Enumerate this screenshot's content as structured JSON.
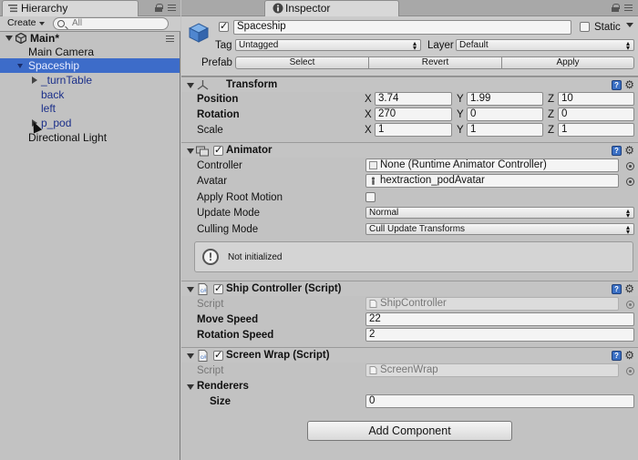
{
  "hierarchy": {
    "tab_label": "Hierarchy",
    "create_label": "Create",
    "search_placeholder": "All",
    "items": [
      {
        "label": "Main*",
        "icon": "unity-icon"
      },
      {
        "label": "Main Camera"
      },
      {
        "label": "Spaceship",
        "selected": true
      },
      {
        "label": "_turnTable"
      },
      {
        "label": "back"
      },
      {
        "label": "left"
      },
      {
        "label": "p_pod"
      },
      {
        "label": "Directional Light"
      }
    ]
  },
  "inspector": {
    "tab_label": "Inspector",
    "object_name": "Spaceship",
    "static_label": "Static",
    "tag_label": "Tag",
    "tag_value": "Untagged",
    "layer_label": "Layer",
    "layer_value": "Default",
    "prefab_label": "Prefab",
    "prefab_buttons": [
      "Select",
      "Revert",
      "Apply"
    ],
    "transform": {
      "title": "Transform",
      "position_label": "Position",
      "rotation_label": "Rotation",
      "scale_label": "Scale",
      "axis": [
        "X",
        "Y",
        "Z"
      ],
      "position": [
        "3.74",
        "1.99",
        "10"
      ],
      "rotation": [
        "270",
        "0",
        "0"
      ],
      "scale": [
        "1",
        "1",
        "1"
      ]
    },
    "animator": {
      "title": "Animator",
      "controller_label": "Controller",
      "controller_value": "None (Runtime Animator Controller)",
      "avatar_label": "Avatar",
      "avatar_value": "hextraction_podAvatar",
      "root_motion_label": "Apply Root Motion",
      "update_mode_label": "Update Mode",
      "update_mode_value": "Normal",
      "culling_mode_label": "Culling Mode",
      "culling_mode_value": "Cull Update Transforms",
      "notice": "Not initialized"
    },
    "ship_controller": {
      "title": "Ship Controller (Script)",
      "script_label": "Script",
      "script_value": "ShipController",
      "move_speed_label": "Move Speed",
      "move_speed_value": "22",
      "rotation_speed_label": "Rotation Speed",
      "rotation_speed_value": "2"
    },
    "screen_wrap": {
      "title": "Screen Wrap (Script)",
      "script_label": "Script",
      "script_value": "ScreenWrap",
      "renderers_label": "Renderers",
      "size_label": "Size",
      "size_value": "0"
    },
    "add_component_label": "Add Component"
  },
  "colors": {
    "selection": "#3d6cc9",
    "panel": "#c2c2c2",
    "help_icon": "#3a6fc4"
  }
}
